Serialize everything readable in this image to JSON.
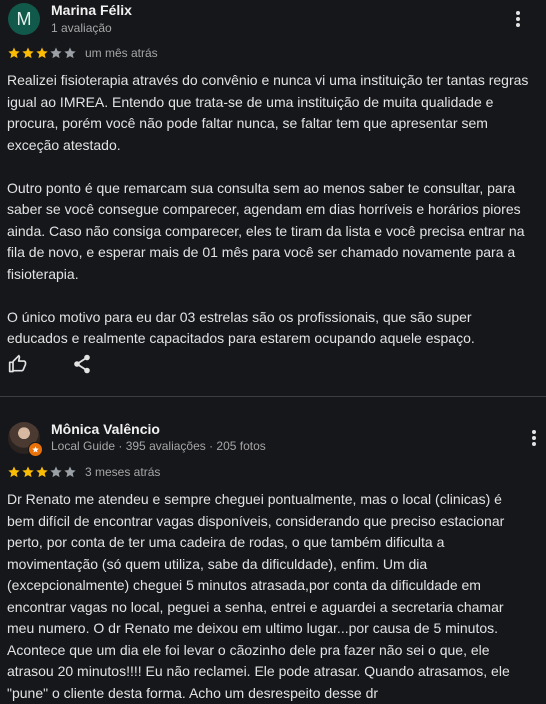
{
  "reviews": [
    {
      "avatar_letter": "M",
      "avatar_color": "#11594a",
      "name": "Marina Félix",
      "meta": "1 avaliação",
      "rating": 3,
      "max_rating": 5,
      "date": "um mês atrás",
      "paragraphs": [
        "Realizei fisioterapia através do convênio e nunca vi uma instituição ter tantas regras igual ao IMREA. Entendo que trata-se de uma instituição de muita qualidade e procura, porém você não pode faltar nunca, se faltar tem que apresentar sem exceção atestado.",
        "Outro ponto é que remarcam sua consulta sem ao menos saber te consultar, para saber se você consegue comparecer, agendam em dias horríveis e horários piores ainda. Caso não consiga comparecer, eles te tiram da lista e você precisa entrar na fila de novo, e esperar mais de 01 mês para você ser chamado novamente para a fisioterapia.",
        "O único motivo para eu dar 03 estrelas são os profissionais, que são super educados e realmente capacitados para estarem ocupando aquele espaço."
      ],
      "icons": {
        "like": "thumbs-up-icon",
        "share": "share-icon",
        "more": "more-vert-icon"
      }
    },
    {
      "name": "Mônica Valêncio",
      "meta": "Local Guide · 395 avaliações · 205 fotos",
      "rating": 3,
      "max_rating": 5,
      "date": "3 meses atrás",
      "paragraphs": [
        "Dr Renato me atendeu e sempre cheguei pontualmente, mas o local (clinicas) é bem difícil de encontrar vagas disponíveis, considerando que preciso estacionar perto, por conta de ter uma cadeira de rodas, o que também dificulta a movimentação (só quem utiliza, sabe da dificuldade), enfim. Um dia (excepcionalmente) cheguei 5 minutos atrasada,por conta da dificuldade em encontrar vagas no local, peguei a senha, entrei e aguardei a secretaria chamar meu numero. O dr Renato me deixou em ultimo lugar...por causa de 5 minutos. Acontece que um dia ele foi levar o cãozinho dele pra fazer não sei o que, ele atrasou 20 minutos!!!! Eu não reclamei. Ele pode atrasar. Quando atrasamos, ele \"pune\" o cliente desta forma. Acho um desrespeito desse dr"
      ],
      "icons": {
        "badge": "local-guide-badge-icon",
        "more": "more-vert-icon"
      }
    }
  ],
  "colors": {
    "background": "#16171b",
    "star_filled": "#fbbc04",
    "star_empty": "#9aa0a6",
    "divider": "#3c3d40"
  }
}
